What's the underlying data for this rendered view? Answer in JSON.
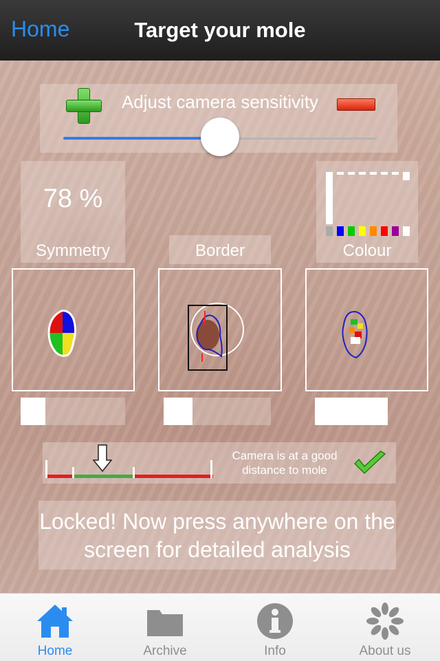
{
  "nav": {
    "back_label": "Home",
    "title": "Target your mole"
  },
  "sensitivity": {
    "label": "Adjust camera sensitivity",
    "level": 0.5
  },
  "symmetry": {
    "value": "78 %",
    "label": "Symmetry"
  },
  "border": {
    "label": "Border"
  },
  "colour": {
    "label": "Colour",
    "swatches": [
      "#0000ff",
      "#00cc00",
      "#ffff00",
      "#ff8800",
      "#ff0000",
      "#990099",
      "#ffffff"
    ]
  },
  "distance": {
    "message": "Camera is at a good distance to mole"
  },
  "instruction": "Locked! Now press anywhere on the screen for detailed analysis",
  "tabs": [
    {
      "label": "Home",
      "icon": "home-icon",
      "active": true
    },
    {
      "label": "Archive",
      "icon": "folder-icon",
      "active": false
    },
    {
      "label": "Info",
      "icon": "info-icon",
      "active": false
    },
    {
      "label": "About us",
      "icon": "flower-icon",
      "active": false
    }
  ],
  "colors": {
    "accent": "#2b8cf0",
    "good": "#44aa44",
    "bad": "#e02020"
  }
}
